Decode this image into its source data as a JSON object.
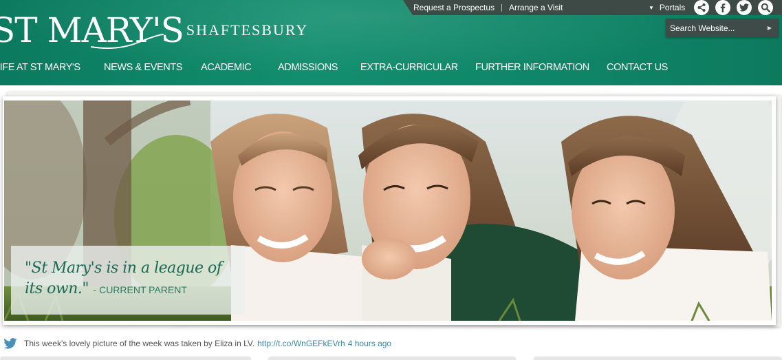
{
  "header": {
    "logo_main": "ST MARY'S",
    "logo_sub": "SHAFTESBURY"
  },
  "utility": {
    "links": [
      "Request a Prospectus",
      "Arrange a Visit"
    ],
    "portals_label": "Portals",
    "icons": [
      "share-icon",
      "facebook-icon",
      "twitter-icon",
      "search-icon"
    ]
  },
  "search": {
    "placeholder": "Search Website..."
  },
  "nav": {
    "items": [
      "LIFE AT ST MARY'S",
      "NEWS & EVENTS",
      "ACADEMIC",
      "ADMISSIONS",
      "EXTRA-CURRICULAR",
      "FURTHER INFORMATION",
      "CONTACT US"
    ]
  },
  "hero": {
    "quote": "\"St Mary's is in a league of its own.\"",
    "attribution": "- CURRENT PARENT"
  },
  "tweet": {
    "icon": "twitter-bird-icon",
    "text": "This week's lovely picture of the week was taken by Eliza in LV.",
    "link": "http://t.co/WnGEFkEVrh",
    "time": "4 hours ago"
  },
  "colors": {
    "brand_green": "#0f8466",
    "utility_bar": "#3d4a46",
    "quote_green": "#1c6a55",
    "link_blue": "#3f87a6"
  }
}
